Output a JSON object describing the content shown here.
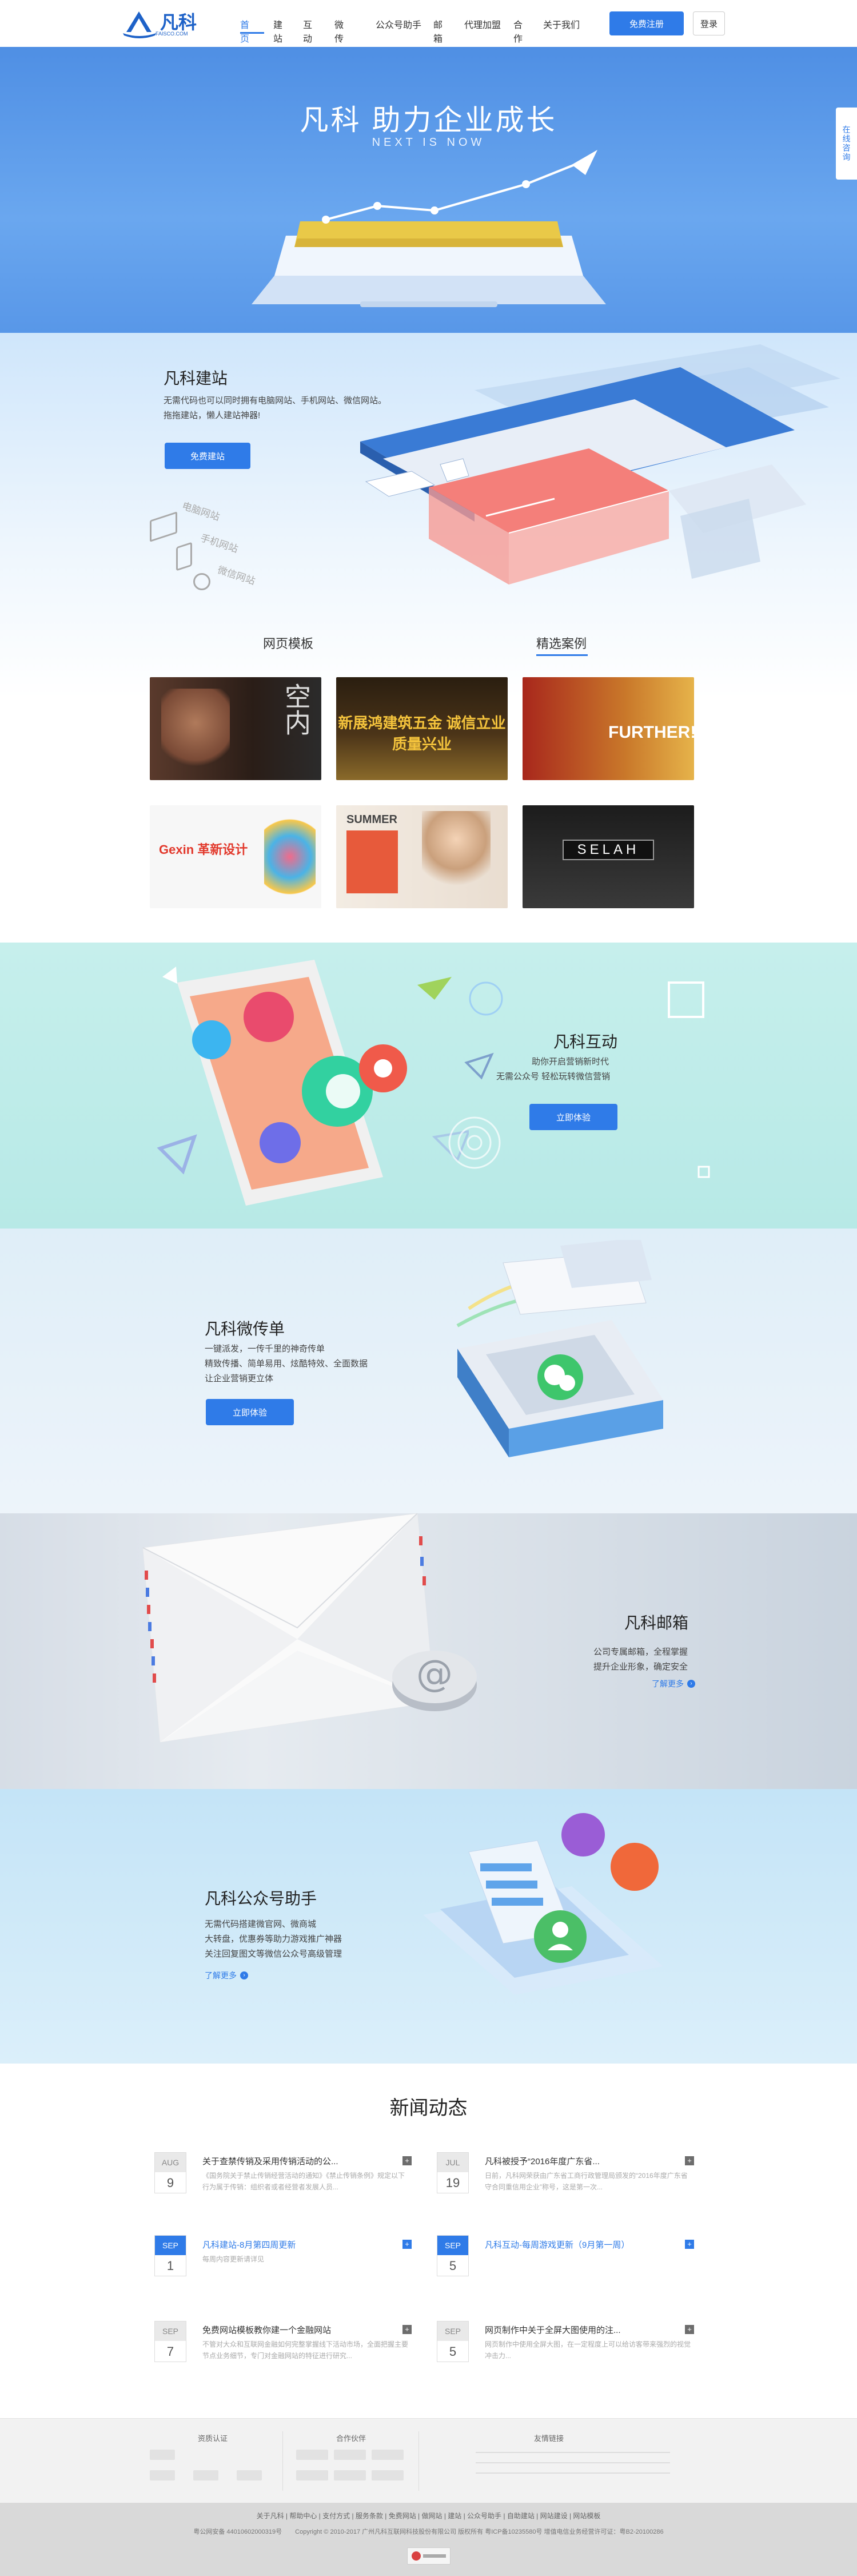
{
  "header": {
    "logo_text": "凡科",
    "logo_sub": "FAISCO.COM",
    "nav": [
      "首页",
      "建站",
      "互动",
      "微传单",
      "公众号助手",
      "邮箱",
      "代理加盟",
      "合作",
      "关于我们"
    ],
    "register_label": "免费注册",
    "login_label": "登录"
  },
  "side_float": {
    "label": "在线咨询"
  },
  "hero": {
    "title": "凡科  助力企业成长",
    "subtitle": "NEXT IS NOW"
  },
  "builder": {
    "title": "凡科建站",
    "desc_line1": "无需代码也可以同时拥有电脑网站、手机网站、微信网站。",
    "desc_line2": "拖拖建站，懒人建站神器!",
    "button": "免费建站",
    "device_labels": [
      "电脑网站",
      "手机网站",
      "微信网站"
    ],
    "tab_templates": "网页模板",
    "tab_cases": "精选案例",
    "thumbs": [
      {
        "name": "thumb-men",
        "text": "MEN 男人的天空内"
      },
      {
        "name": "thumb-hardware",
        "text": "新展鸿建筑五金 诚信立业 质量兴业"
      },
      {
        "name": "thumb-further",
        "text": "FURTHER!"
      },
      {
        "name": "thumb-gexin",
        "text": "Gexin 革新设计"
      },
      {
        "name": "thumb-summer",
        "text": "SUMMER"
      },
      {
        "name": "thumb-selah",
        "text": "SELAH"
      }
    ]
  },
  "interact": {
    "title": "凡科互动",
    "desc_line1": "助你开启营销新时代",
    "desc_line2": "无需公众号 轻松玩转微信营销",
    "button": "立即体验"
  },
  "wechat": {
    "title": "凡科微传单",
    "desc_line1": "一键派发，一传千里的神奇传单",
    "desc_line2": "精致传播、简单易用、炫酷特效、全面数据",
    "desc_line3": "让企业营销更立体",
    "button": "立即体验"
  },
  "mail": {
    "title": "凡科邮箱",
    "desc_line1": "公司专属邮箱，全程掌握",
    "desc_line2": "提升企业形象，确定安全",
    "more": "了解更多"
  },
  "official": {
    "title": "凡科公众号助手",
    "desc_line1": "无需代码搭建微官网、微商城",
    "desc_line2": "大转盘，优惠券等助力游戏推广神器",
    "desc_line3": "关注回复图文等微信公众号高级管理",
    "more": "了解更多"
  },
  "news": {
    "title": "新闻动态",
    "items": [
      {
        "month": "AUG",
        "day": "9",
        "title": "关于查禁传销及采用传销活动的公...",
        "desc": "《国务院关于禁止传销经营活动的通知》《禁止传销条例》规定以下行为属于传销：组织者或者经营者发展人员...",
        "blue": false
      },
      {
        "month": "JUL",
        "day": "19",
        "title": "凡科被授予“2016年度广东省...",
        "desc": "日前，凡科网荣获由广东省工商行政管理局颁发的“2016年度广东省守合同重信用企业”称号，这是第一次...",
        "blue": false
      },
      {
        "month": "SEP",
        "day": "1",
        "title": "凡科建站-8月第四周更新",
        "desc": "每周内容更新请详见",
        "blue": true
      },
      {
        "month": "SEP",
        "day": "5",
        "title": "凡科互动-每周游戏更新（9月第一周）",
        "desc": "",
        "blue": true
      },
      {
        "month": "SEP",
        "day": "7",
        "title": "免费网站模板教你建一个金融网站",
        "desc": "不管对大众和互联网金融如何完整掌握线下活动市场，全面把握主要节点业务细节，专门对金融网站的特征进行研究...",
        "blue": false
      },
      {
        "month": "SEP",
        "day": "5",
        "title": "网页制作中关于全屏大图使用的注...",
        "desc": "网页制作中使用全屏大图，在一定程度上可以给访客带来强烈的视觉冲击力...",
        "blue": false
      }
    ]
  },
  "footer": {
    "col1_title": "资质认证",
    "col2_title": "合作伙伴",
    "col3_title": "友情链接",
    "links": "关于凡科 | 帮助中心 | 支付方式 | 服务条款 | 免费网站 | 做网站 | 建站 | 公众号助手 | 自助建站 | 网站建设 | 网站模板",
    "icp": "粤公网安备 44010602000319号",
    "copyright": "Copyright © 2010-2017 广州凡科互联网科技股份有限公司 版权所有 粤ICP备10235580号 增值电信业务经营许可证：粤B2-20100286"
  },
  "colors": {
    "accent": "#2f7be8"
  }
}
